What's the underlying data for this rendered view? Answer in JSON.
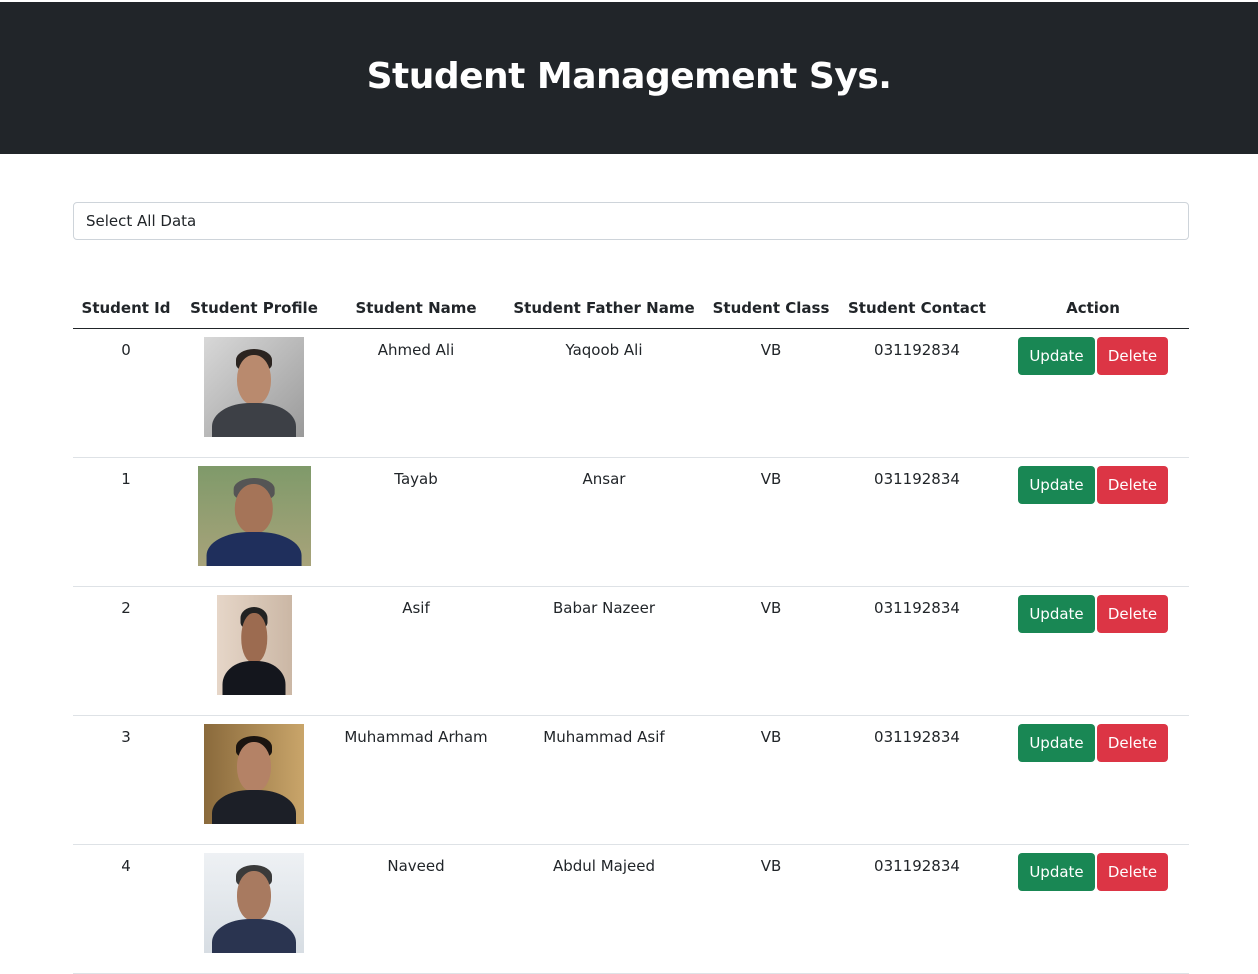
{
  "app": {
    "title": "Student Management Sys."
  },
  "filter": {
    "selected": "Select All Data"
  },
  "table": {
    "headers": [
      "Student Id",
      "Student Profile",
      "Student Name",
      "Student Father Name",
      "Student Class",
      "Student Contact",
      "Action"
    ],
    "update_label": "Update",
    "delete_label": "Delete",
    "rows": [
      {
        "id": "0",
        "name": "Ahmed Ali",
        "father": "Yaqoob Ali",
        "class": "VB",
        "contact": "031192834"
      },
      {
        "id": "1",
        "name": "Tayab",
        "father": "Ansar",
        "class": "VB",
        "contact": "031192834"
      },
      {
        "id": "2",
        "name": "Asif",
        "father": "Babar Nazeer",
        "class": "VB",
        "contact": "031192834"
      },
      {
        "id": "3",
        "name": "Muhammad Arham",
        "father": "Muhammad Asif",
        "class": "VB",
        "contact": "031192834"
      },
      {
        "id": "4",
        "name": "Naveed",
        "father": "Abdul Majeed",
        "class": "VB",
        "contact": "031192834"
      }
    ]
  },
  "colors": {
    "header_bg": "#212529",
    "update": "#198754",
    "delete": "#dc3545"
  }
}
